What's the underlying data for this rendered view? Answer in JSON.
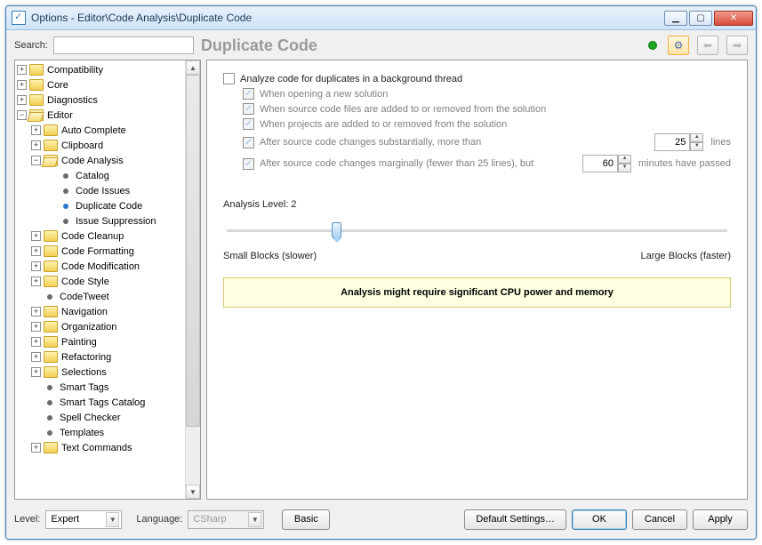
{
  "window": {
    "title": "Options - Editor\\Code Analysis\\Duplicate Code"
  },
  "header": {
    "search_label": "Search:",
    "page_title": "Duplicate Code"
  },
  "tree": {
    "items": [
      {
        "label": "Compatibility",
        "type": "folder",
        "exp": "+",
        "indent": 0
      },
      {
        "label": "Core",
        "type": "folder",
        "exp": "+",
        "indent": 0
      },
      {
        "label": "Diagnostics",
        "type": "folder",
        "exp": "+",
        "indent": 0
      },
      {
        "label": "Editor",
        "type": "folder-open",
        "exp": "−",
        "indent": 0
      },
      {
        "label": "Auto Complete",
        "type": "folder",
        "exp": "+",
        "indent": 1
      },
      {
        "label": "Clipboard",
        "type": "folder",
        "exp": "+",
        "indent": 1
      },
      {
        "label": "Code Analysis",
        "type": "folder-open",
        "exp": "−",
        "indent": 1
      },
      {
        "label": "Catalog",
        "type": "leaf",
        "indent": 2
      },
      {
        "label": "Code Issues",
        "type": "leaf",
        "indent": 2
      },
      {
        "label": "Duplicate Code",
        "type": "leaf",
        "indent": 2,
        "selected": true
      },
      {
        "label": "Issue Suppression",
        "type": "leaf",
        "indent": 2
      },
      {
        "label": "Code Cleanup",
        "type": "folder",
        "exp": "+",
        "indent": 1
      },
      {
        "label": "Code Formatting",
        "type": "folder",
        "exp": "+",
        "indent": 1
      },
      {
        "label": "Code Modification",
        "type": "folder",
        "exp": "+",
        "indent": 1
      },
      {
        "label": "Code Style",
        "type": "folder",
        "exp": "+",
        "indent": 1
      },
      {
        "label": "CodeTweet",
        "type": "leaf",
        "indent": 1
      },
      {
        "label": "Navigation",
        "type": "folder",
        "exp": "+",
        "indent": 1
      },
      {
        "label": "Organization",
        "type": "folder",
        "exp": "+",
        "indent": 1
      },
      {
        "label": "Painting",
        "type": "folder",
        "exp": "+",
        "indent": 1
      },
      {
        "label": "Refactoring",
        "type": "folder",
        "exp": "+",
        "indent": 1
      },
      {
        "label": "Selections",
        "type": "folder",
        "exp": "+",
        "indent": 1
      },
      {
        "label": "Smart Tags",
        "type": "leaf",
        "indent": 1
      },
      {
        "label": "Smart Tags Catalog",
        "type": "leaf",
        "indent": 1
      },
      {
        "label": "Spell Checker",
        "type": "leaf",
        "indent": 1
      },
      {
        "label": "Templates",
        "type": "leaf",
        "indent": 1
      },
      {
        "label": "Text Commands",
        "type": "folder",
        "exp": "+",
        "indent": 1
      }
    ]
  },
  "options": {
    "analyze_label": "Analyze code for duplicates in a background thread",
    "sub1": "When opening a new solution",
    "sub2": "When source code files are added to or removed from the solution",
    "sub3": "When projects are added to or removed from the solution",
    "sub4": "After source code changes substantially, more than",
    "sub4_value": "25",
    "sub4_unit": "lines",
    "sub5": "After source code changes marginally (fewer than 25 lines), but",
    "sub5_value": "60",
    "sub5_unit": "minutes have passed",
    "level_label": "Analysis Level: 2",
    "slider_min": "Small Blocks (slower)",
    "slider_max": "Large Blocks (faster)",
    "warning": "Analysis might require significant CPU power and memory"
  },
  "footer": {
    "level_label": "Level:",
    "level_value": "Expert",
    "lang_label": "Language:",
    "lang_value": "CSharp",
    "basic": "Basic",
    "defaults": "Default Settings…",
    "ok": "OK",
    "cancel": "Cancel",
    "apply": "Apply"
  }
}
